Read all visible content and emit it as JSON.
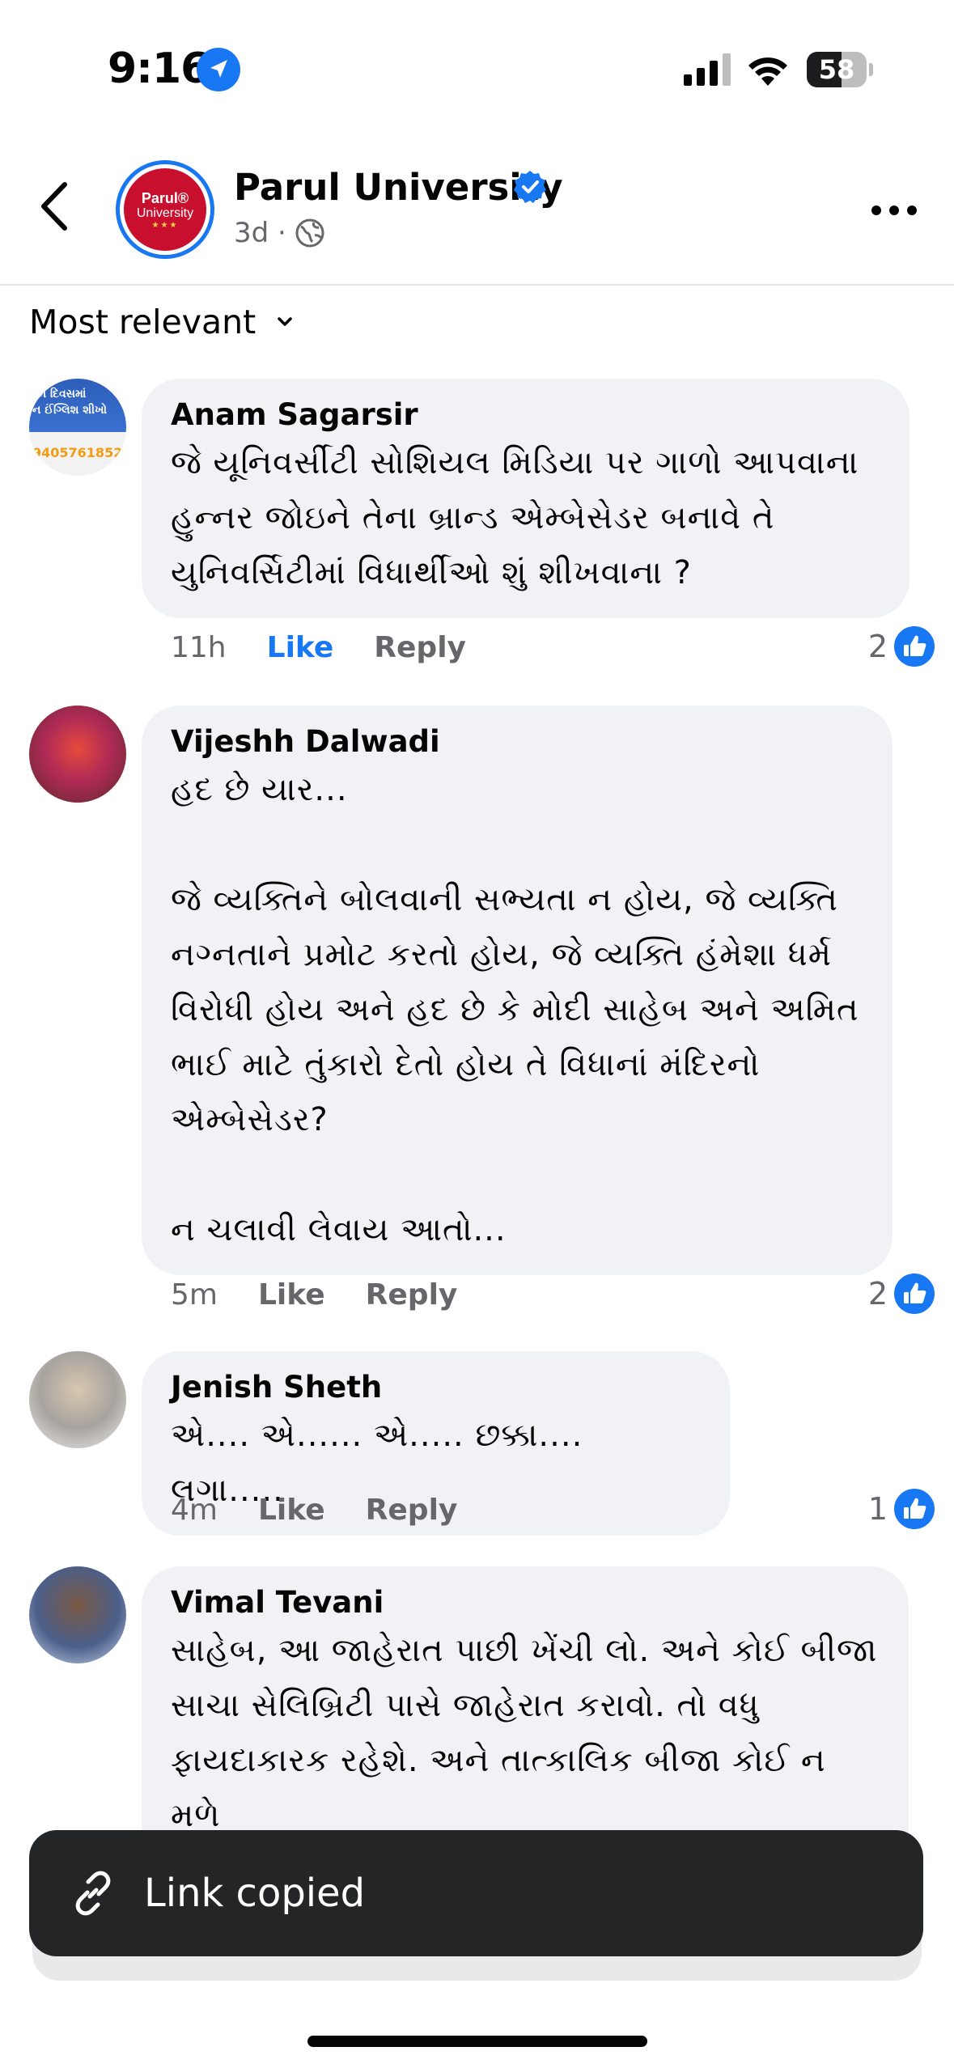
{
  "status_bar": {
    "time": "9:16",
    "battery_level": "58"
  },
  "header": {
    "page_name": "Parul University",
    "post_age": "3d",
    "avatar_text_1": "Parul®",
    "avatar_text_2": "University"
  },
  "filter": {
    "label": "Most relevant"
  },
  "comments": [
    {
      "author": "Anam Sagarsir",
      "text": "જે યૂનિવર્સીટી સોશિયલ મિડિયા પર ગાળો આપવાના\nહુન્નર જોઇને તેના બ્રાન્ડ એમ્બેસેડર બનાવે તે\nયુનિવર્સિટીમાં વિધાર્થીઓ શું શીખવાના ?",
      "time": "11h",
      "like_label": "Like",
      "reply_label": "Reply",
      "reaction_count": "2",
      "avatar_text_1": "ી દિવસમાં",
      "avatar_text_2": "ન ઈંગ્લિશ શીખો",
      "avatar_text_3": "9405761852"
    },
    {
      "author": "Vijeshh Dalwadi",
      "text": "હદ છે યાર...\n\nજે વ્યક્તિને બોલવાની સભ્યતા ન હોય, જે વ્યક્તિ\nનગ્નતાને પ્રમોટ કરતો હોય, જે વ્યક્તિ હંમેશા ધર્મ\nવિરોધી હોય અને હદ છે કે મોદી સાહેબ અને અમિત\nભાઈ માટે તુંકારો દેતો હોય તે વિધાનાં મંદિરનો\nએમ્બેસેડર?\n\nન ચલાવી લેવાય આતો...",
      "time": "5m",
      "like_label": "Like",
      "reply_label": "Reply",
      "reaction_count": "2"
    },
    {
      "author": "Jenish Sheth",
      "text": "એ.... એ...... એ..... છક્કા.... લગા.....",
      "time": "4m",
      "like_label": "Like",
      "reply_label": "Reply",
      "reaction_count": "1"
    },
    {
      "author": "Vimal Tevani",
      "text": "સાહેબ, આ જાહેરાત પાછી ખેંચી લો. અને કોઈ બીજા\nસાચા સેલિબ્રિટી પાસે જાહેરાત કરાવો. તો વધુ\nફાયદાકારક રહેશે. અને તાત્કાલિક બીજા કોઈ ન મળે\nતો આને તો બંધ જ કરો નહીંતર નેગેટિવ ઇમેજ કદાચ"
    }
  ],
  "toast": {
    "text": "Link copied"
  },
  "colors": {
    "accent": "#1877f2",
    "bubble": "#f0f2f5",
    "muted": "#65676b",
    "toast": "#242526"
  }
}
